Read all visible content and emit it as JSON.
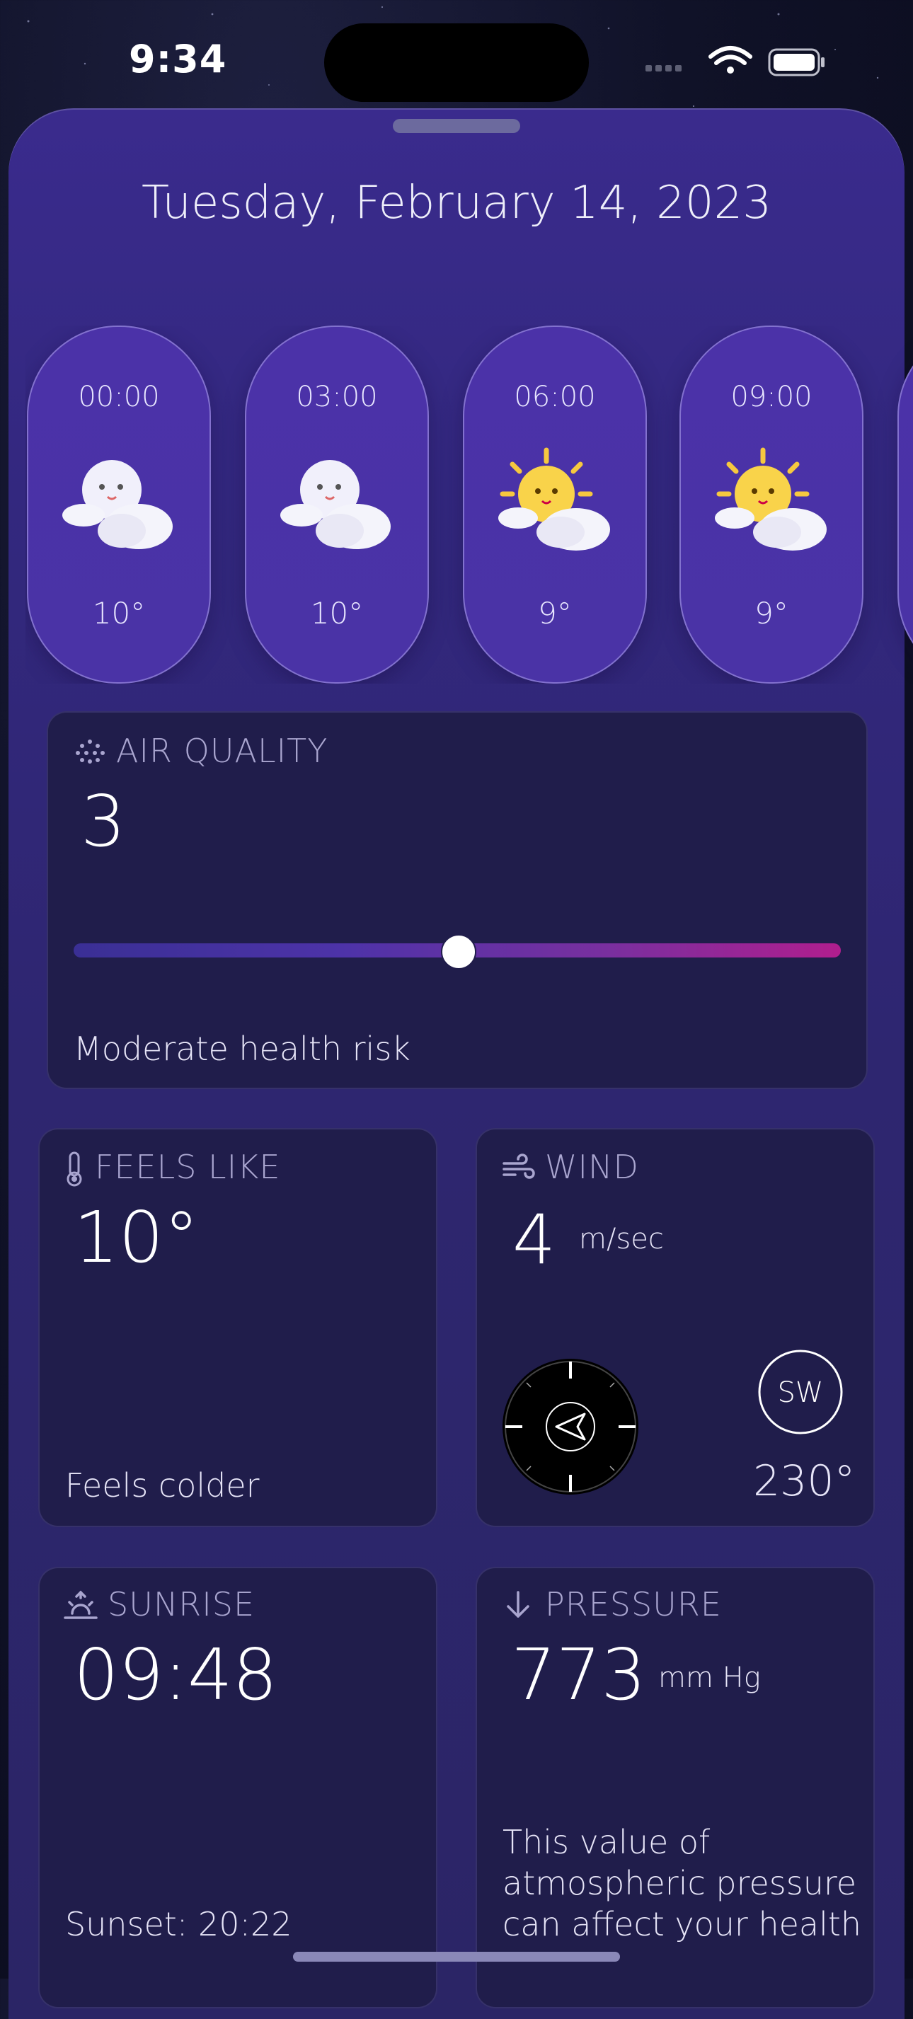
{
  "status_bar": {
    "time": "9:34"
  },
  "date": "Tuesday, February 14, 2023",
  "hourly": [
    {
      "time": "00:00",
      "temp": "10°",
      "icon": "moon-cloud-icon"
    },
    {
      "time": "03:00",
      "temp": "10°",
      "icon": "moon-cloud-icon"
    },
    {
      "time": "06:00",
      "temp": "9°",
      "icon": "sun-cloud-icon"
    },
    {
      "time": "09:00",
      "temp": "9°",
      "icon": "sun-cloud-icon"
    }
  ],
  "air_quality": {
    "title": "AIR QUALITY",
    "value": "3",
    "level": 0.5,
    "description": "Moderate health risk"
  },
  "feels_like": {
    "title": "FEELS LIKE",
    "value": "10°",
    "description": "Feels colder"
  },
  "wind": {
    "title": "WIND",
    "value": "4",
    "unit": "m/sec",
    "direction": "SW",
    "degrees": "230°"
  },
  "sunrise": {
    "title": "SUNRISE",
    "value": "09:48",
    "sunset": "Sunset: 20:22"
  },
  "pressure": {
    "title": "PRESSURE",
    "value": "773",
    "unit": "mm Hg",
    "description_lines": [
      "This value of",
      "atmospheric pressure",
      "can affect your health"
    ]
  },
  "colors": {
    "background": "#101228",
    "sheet": "#33287f",
    "card": "#201d4b",
    "pill": "#4b32a8",
    "accent_pink": "#b01e8e"
  }
}
